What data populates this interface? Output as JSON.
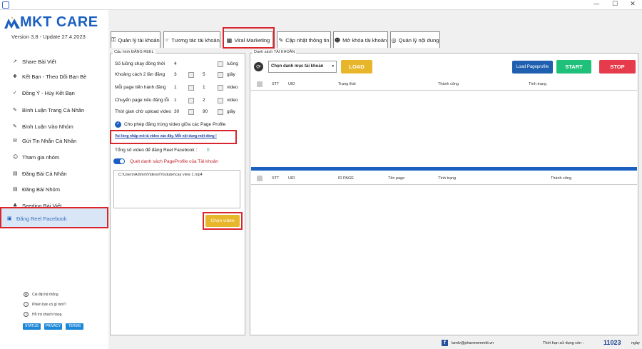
{
  "app": {
    "brand": "MKT CARE",
    "version": "Version 3.8 - Update 27.4.2023"
  },
  "window": {
    "minimize": "—",
    "maximize": "☐",
    "close": "✕"
  },
  "sidebar": {
    "items": [
      {
        "label": "Share Bài Viết",
        "icon": "share-icon"
      },
      {
        "label": "Kết Bạn - Theo Dõi Bạn Bè",
        "icon": "add-friend-icon"
      },
      {
        "label": "Đồng Ý - Hủy Kết Bạn",
        "icon": "accept-friend-icon"
      },
      {
        "label": "Bình Luận Trang Cá Nhân",
        "icon": "comment-icon"
      },
      {
        "label": "Bình Luận Vào Nhóm",
        "icon": "group-comment-icon"
      },
      {
        "label": "Gửi Tin Nhắn Cá Nhân",
        "icon": "message-icon"
      },
      {
        "label": "Tham gia nhóm",
        "icon": "join-group-icon"
      },
      {
        "label": "Đăng Bài Cá Nhân",
        "icon": "post-icon"
      },
      {
        "label": "Đăng Bài Nhóm",
        "icon": "group-post-icon"
      },
      {
        "label": "Seeding Bài Viết",
        "icon": "seeding-icon"
      },
      {
        "label": "Đăng Reel Facebook",
        "icon": "reel-icon"
      }
    ],
    "footer": [
      {
        "label": "Cài đặt hệ thống",
        "icon": "settings-icon"
      },
      {
        "label": "Phiên bản có gì mới?",
        "icon": "info-icon"
      },
      {
        "label": "Hỗ trợ khách hàng",
        "icon": "help-icon"
      }
    ],
    "pills": [
      "STATUS",
      "PRIVACY",
      "TERMS"
    ]
  },
  "tabs": [
    {
      "label": "Quản lý tài khoản",
      "icon": "key-icon"
    },
    {
      "label": "Tương tác tài khoản",
      "icon": "interact-icon"
    },
    {
      "label": "Viral Marketing",
      "icon": "calendar-icon"
    },
    {
      "label": "Cập nhật thông tin",
      "icon": "edit-icon"
    },
    {
      "label": "Mở khóa tài khoản",
      "icon": "unlock-icon"
    },
    {
      "label": "Quản lý nội dung",
      "icon": "content-icon"
    }
  ],
  "config": {
    "title": "Cấu hình ĐĂNG REEL",
    "rows": [
      {
        "label": "Số luồng chạy đồng thời",
        "a": "4",
        "b": "",
        "unit": "luồng"
      },
      {
        "label": "Khoảng cách 2 lần đăng",
        "a": "3",
        "b": "5",
        "unit": "giây"
      },
      {
        "label": "Mỗi page tiến hành đăng",
        "a": "1",
        "b": "1",
        "unit": "video"
      },
      {
        "label": "Chuyển page nếu đăng lỗi",
        "a": "1",
        "b": "2",
        "unit": "video"
      },
      {
        "label": "Thời gian chờ upload video",
        "a": "30",
        "b": "90",
        "unit": "giây"
      }
    ],
    "allow_duplicate": "Cho phép đăng trùng video giữa các Page Profile",
    "hint_link": "Vui lòng nhập mô tả video vào đây. Mỗi nội dung một dòng !",
    "total_label": "Tổng số video để đăng Reel Facebook :",
    "total_value": "0",
    "scan_label": "Quét danh sách PageProfile của Tài khoản",
    "file_path": "C:\\Users\\Admin\\Videos\\Youtube\\cay view 1.mp4",
    "choose_video": "Chọn video"
  },
  "accounts": {
    "title": "Danh sách TÀI KHOẢN",
    "category_select": "Chọn danh mục tài khoản",
    "load": "LOAD",
    "load_pageprofile": "Load Pageprofile",
    "start": "START",
    "stop": "STOP",
    "top_columns": [
      "STT",
      "UID",
      "Trạng thái",
      "Thành công",
      "Tình trạng"
    ],
    "bottom_columns": [
      "STT",
      "UID",
      "ID PAGE",
      "Tên page",
      "Tình trạng",
      "Thành công"
    ]
  },
  "status": {
    "email": "lamlv@phanmemmkt.vn",
    "remaining_label": "Thời hạn sử dụng còn :",
    "remaining_value": "11023",
    "remaining_unit": "ngày"
  },
  "colors": {
    "brand": "#1b5fc0",
    "start": "#1fc07a",
    "stop": "#e53b4a",
    "load": "#e8b62a",
    "load_pageprofile": "#1e5fb0",
    "highlight": "#d9262c"
  }
}
